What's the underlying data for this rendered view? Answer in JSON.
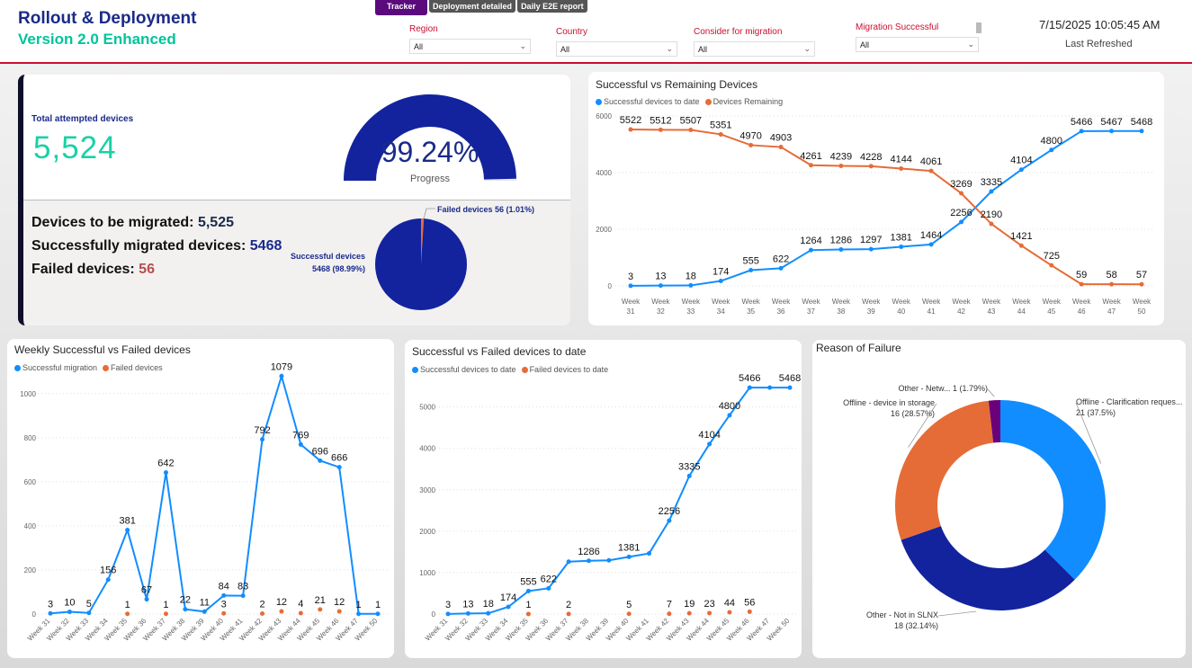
{
  "header": {
    "title": "Rollout & Deployment",
    "subtitle": "Version 2.0 Enhanced",
    "tabs": [
      "Tracker",
      "Deployment detailed",
      "Daily E2E report"
    ],
    "datetime": "7/15/2025 10:05:45 AM",
    "refresh_label": "Last Refreshed",
    "filters": [
      {
        "label": "Region",
        "value": "All"
      },
      {
        "label": "Country",
        "value": "All"
      },
      {
        "label": "Consider for migration",
        "value": "All"
      },
      {
        "label": "Migration Successful",
        "value": "All"
      }
    ]
  },
  "kpi": {
    "total_label": "Total attempted devices",
    "total_value": "5,524",
    "progress_value": "99.24%",
    "progress_fraction": 0.9924,
    "progress_label": "Progress",
    "to_migrate_label": "Devices to be migrated:",
    "to_migrate_value": "5,525",
    "success_label": "Successfully migrated devices:",
    "success_value": "5468",
    "failed_label": "Failed devices:",
    "failed_value": "56",
    "pie_success_label": "Successful devices",
    "pie_success_value": "5468 (98.99%)",
    "pie_failed_label": "Failed devices 56 (1.01%)",
    "pie_failed_fraction": 0.0101
  },
  "colors": {
    "navy": "#13239e",
    "blue": "#118dff",
    "orange": "#e66c37",
    "purple": "#6b007b",
    "teal": "#19d1a6",
    "red": "#c8102e"
  },
  "chart_data": [
    {
      "type": "line",
      "title": "Successful vs Remaining Devices",
      "categories": [
        "Week 31",
        "Week 32",
        "Week 33",
        "Week 34",
        "Week 35",
        "Week 36",
        "Week 37",
        "Week 38",
        "Week 39",
        "Week 40",
        "Week 41",
        "Week 42",
        "Week 43",
        "Week 44",
        "Week 45",
        "Week 46",
        "Week 47",
        "Week 50"
      ],
      "series": [
        {
          "name": "Successful devices to date",
          "color": "#118dff",
          "values": [
            3,
            13,
            18,
            174,
            555,
            622,
            1264,
            1286,
            1297,
            1381,
            1464,
            2256,
            3335,
            4104,
            4800,
            5466,
            5467,
            5468
          ]
        },
        {
          "name": "Devices Remaining",
          "color": "#e66c37",
          "values": [
            5522,
            5512,
            5507,
            5351,
            4970,
            4903,
            4261,
            4239,
            4228,
            4144,
            4061,
            3269,
            2190,
            1421,
            725,
            59,
            58,
            57
          ]
        }
      ],
      "yticks": [
        0,
        2000,
        4000,
        6000
      ],
      "ylim": [
        0,
        6000
      ],
      "grid": true,
      "legend": "top-left"
    },
    {
      "type": "line",
      "title": "Weekly Successful vs Failed devices",
      "categories": [
        "Week 31",
        "Week 32",
        "Week 33",
        "Week 34",
        "Week 35",
        "Week 36",
        "Week 37",
        "Week 38",
        "Week 39",
        "Week 40",
        "Week 41",
        "Week 42",
        "Week 43",
        "Week 44",
        "Week 45",
        "Week 46",
        "Week 47",
        "Week 50"
      ],
      "series": [
        {
          "name": "Successful migration",
          "color": "#118dff",
          "style": "line",
          "values": [
            3,
            10,
            5,
            156,
            381,
            67,
            642,
            22,
            11,
            84,
            83,
            792,
            1079,
            769,
            696,
            666,
            1,
            1
          ]
        },
        {
          "name": "Failed devices",
          "color": "#e66c37",
          "style": "points",
          "values": [
            null,
            null,
            null,
            null,
            1,
            null,
            1,
            null,
            null,
            3,
            null,
            2,
            12,
            4,
            21,
            12,
            null,
            null
          ]
        }
      ],
      "yticks": [
        0,
        200,
        400,
        600,
        800,
        1000
      ],
      "ylim": [
        0,
        1150
      ],
      "grid": true,
      "legend": "top-left"
    },
    {
      "type": "line",
      "title": "Successful vs Failed devices to date",
      "categories": [
        "Week 31",
        "Week 32",
        "Week 33",
        "Week 34",
        "Week 35",
        "Week 36",
        "Week 37",
        "Week 38",
        "Week 39",
        "Week 40",
        "Week 41",
        "Week 42",
        "Week 43",
        "Week 44",
        "Week 45",
        "Week 46",
        "Week 47",
        "Week 50"
      ],
      "series": [
        {
          "name": "Successful devices to date",
          "color": "#118dff",
          "style": "line",
          "values": [
            3,
            13,
            18,
            174,
            555,
            622,
            1264,
            1286,
            1297,
            1381,
            1464,
            2256,
            3335,
            4104,
            4800,
            5466,
            5467,
            5468
          ],
          "labels": [
            true,
            true,
            true,
            true,
            true,
            true,
            false,
            true,
            false,
            true,
            false,
            true,
            true,
            true,
            true,
            true,
            false,
            true
          ]
        },
        {
          "name": "Failed devices to date",
          "color": "#e66c37",
          "style": "points",
          "values": [
            null,
            null,
            null,
            null,
            1,
            null,
            2,
            null,
            null,
            5,
            null,
            7,
            19,
            23,
            44,
            56,
            null,
            null
          ]
        }
      ],
      "yticks": [
        0,
        1000,
        2000,
        3000,
        4000,
        5000
      ],
      "ylim": [
        0,
        5600
      ],
      "grid": true,
      "legend": "top-left"
    },
    {
      "type": "pie",
      "title": "Reason of Failure",
      "donut": true,
      "slices": [
        {
          "name": "Offline - Clarification reques...",
          "value": 21,
          "pct": "37.5%",
          "color": "#118dff"
        },
        {
          "name": "Other - Not in SLNX",
          "value": 18,
          "pct": "32.14%",
          "color": "#13239e"
        },
        {
          "name": "Offline - device in storage",
          "value": 16,
          "pct": "28.57%",
          "color": "#e66c37"
        },
        {
          "name": "Other - Netw...",
          "value": 1,
          "pct": "1.79%",
          "color": "#6b007b"
        }
      ]
    }
  ]
}
